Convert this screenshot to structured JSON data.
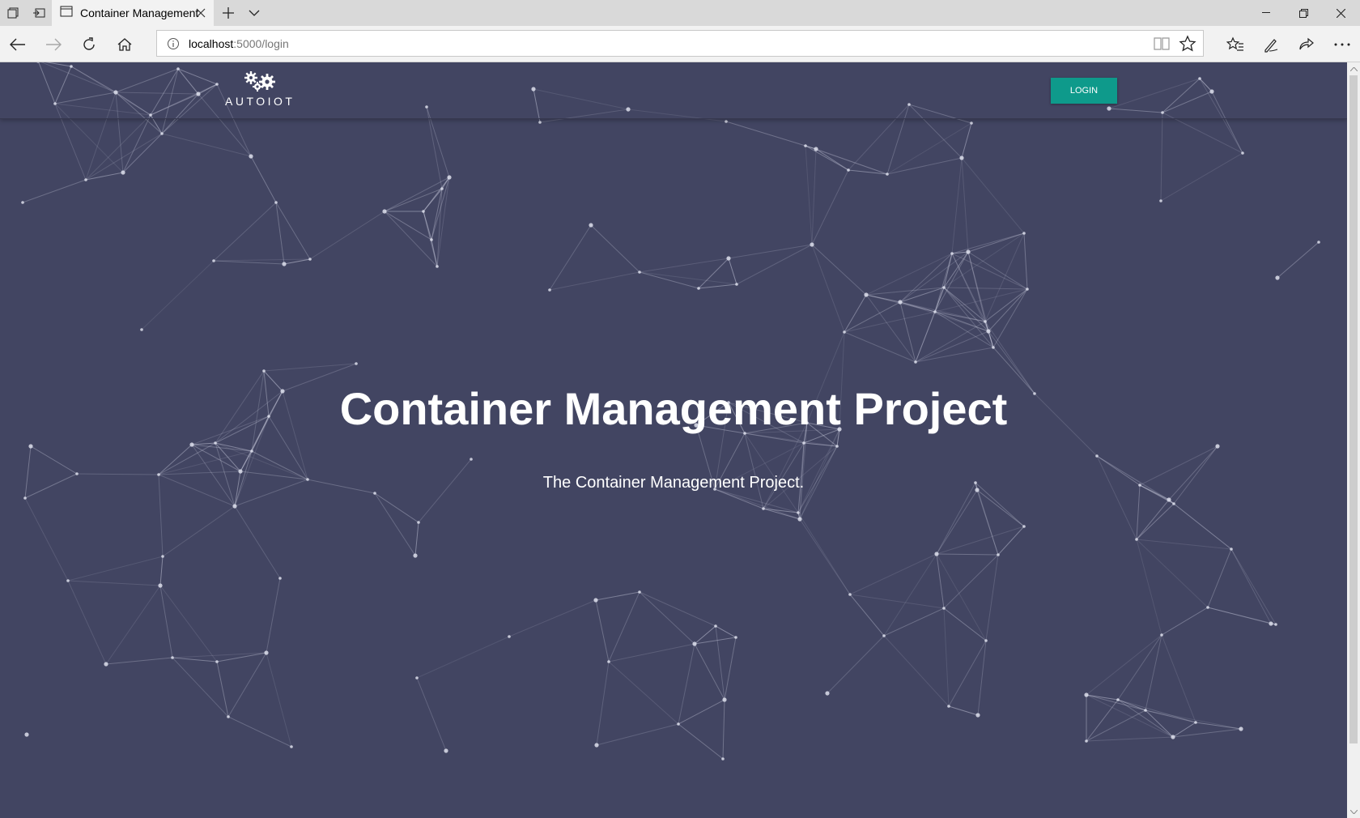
{
  "browser": {
    "tab_title": "Container Management",
    "url_host": "localhost",
    "url_path": ":5000/login"
  },
  "header": {
    "logo_text": "AUTOIOT",
    "login_label": "LOGIN"
  },
  "hero": {
    "title": "Container Management Project",
    "subtitle": "The Container Management Project."
  },
  "colors": {
    "page_bg": "#424562",
    "accent": "#0e9a8b"
  }
}
